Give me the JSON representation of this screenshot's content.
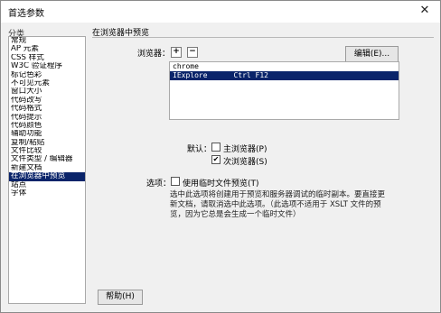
{
  "window": {
    "title": "首选参数",
    "close_glyph": "✕"
  },
  "categories": {
    "header": "分类",
    "items": [
      "常规",
      "AP 元素",
      "CSS 样式",
      "W3C 验证程序",
      "标记色彩",
      "不可见元素",
      "窗口大小",
      "代码改写",
      "代码格式",
      "代码提示",
      "代码颜色",
      "辅助功能",
      "复制/粘贴",
      "文件比较",
      "文件类型 / 编辑器",
      "新建文档",
      "在浏览器中预览",
      "站点",
      "字体"
    ],
    "selected": "在浏览器中预览"
  },
  "section": {
    "title": "在浏览器中预览",
    "browsers_label": "浏览器：",
    "add_glyph": "+",
    "remove_glyph": "−",
    "edit_button": "编辑(E)...",
    "browser_list": [
      {
        "name": "chrome",
        "shortcut": ""
      },
      {
        "name": "IExplore",
        "shortcut": "Ctrl F12"
      }
    ],
    "selected_browser": "IExplore",
    "default_label": "默认：",
    "primary_browser": {
      "label": "主浏览器(P)",
      "checked": false
    },
    "secondary_browser": {
      "label": "次浏览器(S)",
      "checked": true
    },
    "options_label": "选项：",
    "temp_file": {
      "label": "使用临时文件预览(T)",
      "checked": false
    },
    "description_lines": [
      "选中此选项将创建用于预览和服务器调试的临时副本。要直接更",
      "新文档，请取消选中此选项。（此选项不适用于 XSLT 文件的预",
      "览，因为它总是会生成一个临时文件）"
    ]
  },
  "footer": {
    "help_button": "帮助(H)"
  },
  "colors": {
    "selection": "#0a246a",
    "window_bg": "#f0f0f0"
  }
}
